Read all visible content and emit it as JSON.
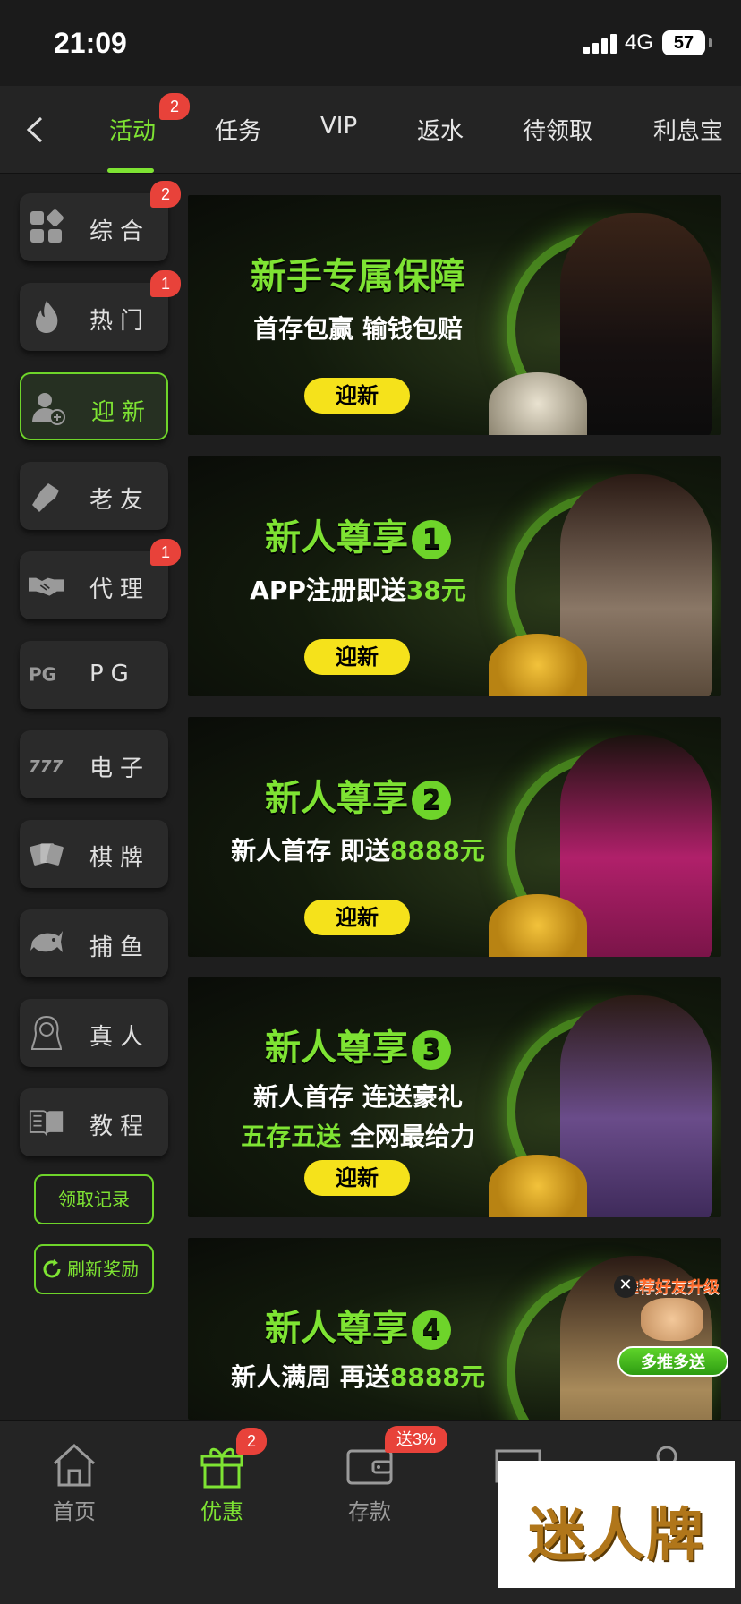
{
  "status_bar": {
    "time": "21:09",
    "network": "4G",
    "battery": "57"
  },
  "top_tabs": [
    {
      "label": "活动",
      "active": true,
      "badge": "2"
    },
    {
      "label": "任务"
    },
    {
      "label": "VIP"
    },
    {
      "label": "返水"
    },
    {
      "label": "待领取"
    },
    {
      "label": "利息宝"
    }
  ],
  "sidebar": {
    "items": [
      {
        "label": "综合",
        "icon": "grid-icon",
        "badge": "2"
      },
      {
        "label": "热门",
        "icon": "flame-icon",
        "badge": "1"
      },
      {
        "label": "迎新",
        "icon": "user-add-icon",
        "active": true
      },
      {
        "label": "老友",
        "icon": "handshake-fist-icon"
      },
      {
        "label": "代理",
        "icon": "handshake-icon",
        "badge": "1"
      },
      {
        "label": "PG",
        "icon": "pg-logo-icon"
      },
      {
        "label": "电子",
        "icon": "slot-777-icon"
      },
      {
        "label": "棋牌",
        "icon": "cards-icon"
      },
      {
        "label": "捕鱼",
        "icon": "fish-icon"
      },
      {
        "label": "真人",
        "icon": "live-dealer-icon"
      },
      {
        "label": "教程",
        "icon": "book-icon"
      }
    ],
    "claim_records": "领取记录",
    "refresh_rewards": "刷新奖励"
  },
  "banners": [
    {
      "title": "新手专属保障",
      "line1": "首存包赢 输钱包赔",
      "cta": "迎新"
    },
    {
      "title": "新人尊享",
      "num": "1",
      "line1_pre": "APP注册即送",
      "line1_hl": "38元",
      "cta": "迎新"
    },
    {
      "title": "新人尊享",
      "num": "2",
      "line1_pre": "新人首存 即送",
      "line1_hl": "8888元",
      "cta": "迎新"
    },
    {
      "title": "新人尊享",
      "num": "3",
      "line1": "新人首存 连送豪礼",
      "line2_hl": "五存五送",
      "line2": " 全网最给力",
      "cta": "迎新"
    },
    {
      "title": "新人尊享",
      "num": "4",
      "line1_pre": "新人满周 再送",
      "line1_hl": "8888元"
    }
  ],
  "float_promo": {
    "title": "推荐好友升级",
    "button": "多推多送"
  },
  "bottom_nav": [
    {
      "label": "首页",
      "icon": "home-icon"
    },
    {
      "label": "优惠",
      "icon": "gift-icon",
      "active": true,
      "badge": "2"
    },
    {
      "label": "存款",
      "icon": "wallet-icon",
      "badge": "送3%"
    }
  ],
  "brand_watermark": "迷人牌",
  "colors": {
    "accent": "#7ee333",
    "badge": "#e8423a",
    "cta": "#f5e21b",
    "background": "#1e1e1e"
  }
}
